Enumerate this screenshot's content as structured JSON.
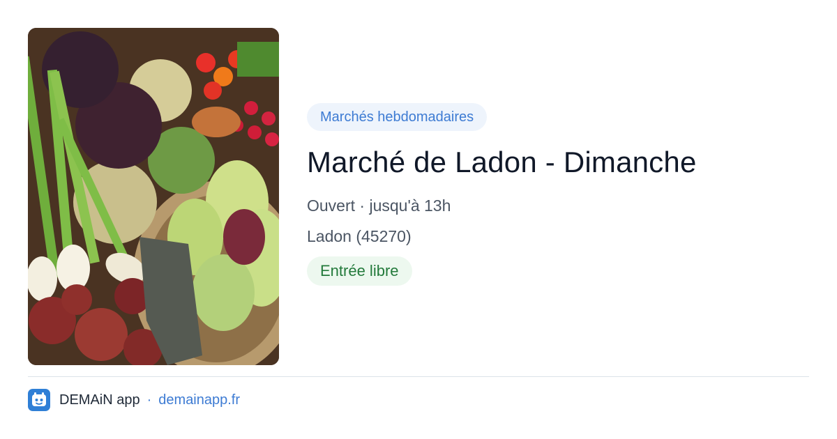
{
  "card": {
    "photo_icon": "vegetable-market-photo",
    "category": "Marchés hebdomadaires",
    "title": "Marché de Ladon - Dimanche",
    "status": "Ouvert · jusqu'à 13h",
    "location": "Ladon (45270)",
    "entry": "Entrée libre"
  },
  "footer": {
    "logo_icon": "demain-app-logo-icon",
    "app_name": "DEMAiN app",
    "separator": "·",
    "url": "demainapp.fr"
  },
  "colors": {
    "accent_blue": "#3d7bd3",
    "tag_blue_bg": "#eef4fc",
    "tag_green_bg": "#edf8ef",
    "tag_green_text": "#237a3b",
    "title": "#101828",
    "muted_text": "#4b5563"
  }
}
